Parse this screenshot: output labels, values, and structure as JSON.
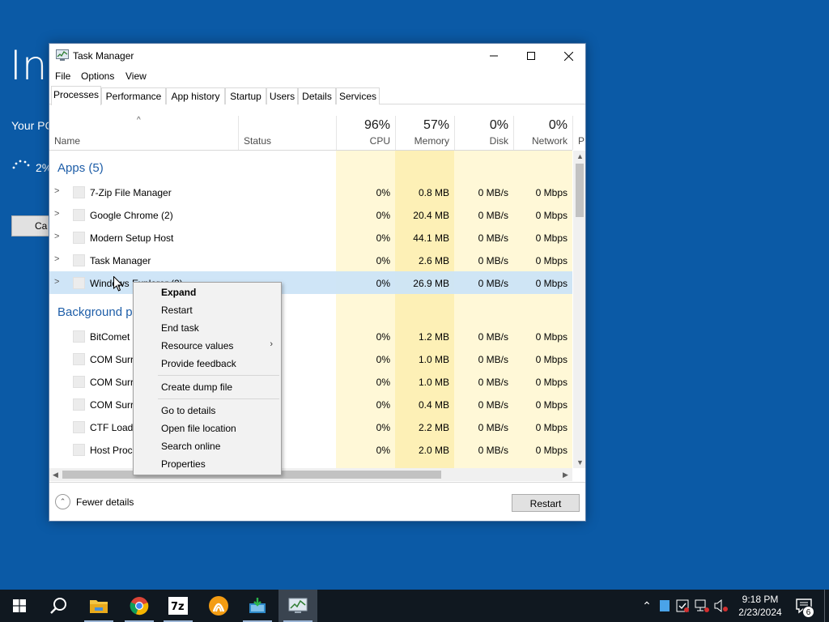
{
  "background": {
    "title": "Ins",
    "subtitle": "Your PC",
    "progress_text": "2%",
    "cancel_label": "Ca"
  },
  "window": {
    "title": "Task Manager",
    "menu": [
      "File",
      "Options",
      "View"
    ],
    "tabs": [
      "Processes",
      "Performance",
      "App history",
      "Startup",
      "Users",
      "Details",
      "Services"
    ],
    "active_tab": "Processes"
  },
  "columns": {
    "name": "Name",
    "status": "Status",
    "cpu": {
      "pct": "96%",
      "label": "CPU"
    },
    "memory": {
      "pct": "57%",
      "label": "Memory"
    },
    "disk": {
      "pct": "0%",
      "label": "Disk"
    },
    "network": {
      "pct": "0%",
      "label": "Network"
    },
    "extra": "P"
  },
  "groups": {
    "apps": "Apps (5)",
    "background": "Background p"
  },
  "apps": [
    {
      "name": "7-Zip File Manager",
      "cpu": "0%",
      "mem": "0.8 MB",
      "disk": "0 MB/s",
      "net": "0 Mbps"
    },
    {
      "name": "Google Chrome (2)",
      "cpu": "0%",
      "mem": "20.4 MB",
      "disk": "0 MB/s",
      "net": "0 Mbps"
    },
    {
      "name": "Modern Setup Host",
      "cpu": "0%",
      "mem": "44.1 MB",
      "disk": "0 MB/s",
      "net": "0 Mbps"
    },
    {
      "name": "Task Manager",
      "cpu": "0%",
      "mem": "2.6 MB",
      "disk": "0 MB/s",
      "net": "0 Mbps"
    },
    {
      "name": "Windows Explorer (2)",
      "cpu": "0%",
      "mem": "26.9 MB",
      "disk": "0 MB/s",
      "net": "0 Mbps"
    }
  ],
  "background_processes": [
    {
      "name": "BitComet",
      "cpu": "0%",
      "mem": "1.2 MB",
      "disk": "0 MB/s",
      "net": "0 Mbps"
    },
    {
      "name": "COM Surr",
      "cpu": "0%",
      "mem": "1.0 MB",
      "disk": "0 MB/s",
      "net": "0 Mbps"
    },
    {
      "name": "COM Surr",
      "cpu": "0%",
      "mem": "1.0 MB",
      "disk": "0 MB/s",
      "net": "0 Mbps"
    },
    {
      "name": "COM Surr",
      "cpu": "0%",
      "mem": "0.4 MB",
      "disk": "0 MB/s",
      "net": "0 Mbps"
    },
    {
      "name": "CTF Loade",
      "cpu": "0%",
      "mem": "2.2 MB",
      "disk": "0 MB/s",
      "net": "0 Mbps"
    },
    {
      "name": "Host Proc",
      "cpu": "0%",
      "mem": "2.0 MB",
      "disk": "0 MB/s",
      "net": "0 Mbps"
    }
  ],
  "context_menu": {
    "items": [
      "Expand",
      "Restart",
      "End task",
      "Resource values",
      "Provide feedback",
      "Create dump file",
      "Go to details",
      "Open file location",
      "Search online",
      "Properties"
    ]
  },
  "footer": {
    "fewer_details": "Fewer details",
    "restart": "Restart"
  },
  "taskbar": {
    "time": "9:18 PM",
    "date": "2/23/2024",
    "notification_count": "6"
  }
}
